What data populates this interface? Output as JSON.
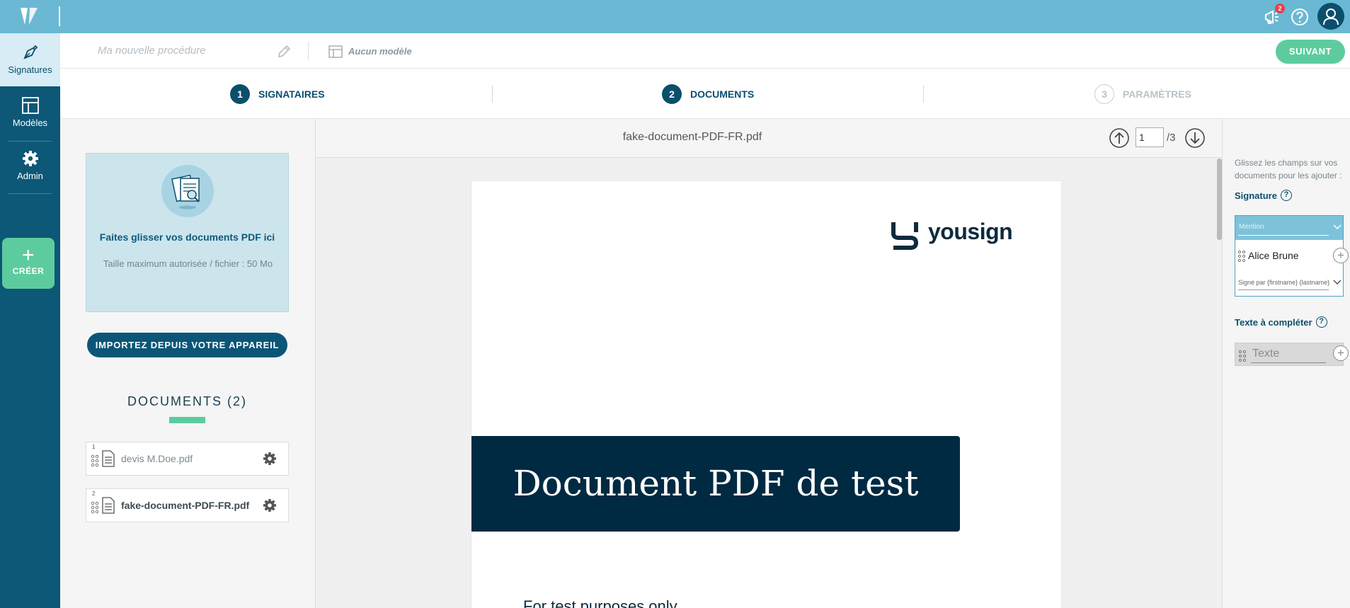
{
  "topbar": {
    "notification_count": "2"
  },
  "sidebar": {
    "items": [
      {
        "label": "Signatures",
        "icon": "pen-nib-icon",
        "active": true
      },
      {
        "label": "Modèles",
        "icon": "layout-icon",
        "active": false
      },
      {
        "label": "Admin",
        "icon": "gear-icon",
        "active": false
      }
    ],
    "create_label": "CRÉER",
    "create_symbol": "+"
  },
  "subheader": {
    "procedure_name": "Ma nouvelle procédure",
    "template_name": "Aucun modèle",
    "next_label": "SUIVANT"
  },
  "steps": [
    {
      "num": "1",
      "label": "SIGNATAIRES",
      "state": "done"
    },
    {
      "num": "2",
      "label": "DOCUMENTS",
      "state": "active"
    },
    {
      "num": "3",
      "label": "PARAMÈTRES",
      "state": "inactive"
    }
  ],
  "dropzone": {
    "title": "Faites glisser vos documents PDF ici",
    "subtitle": "Taille maximum autorisée / fichier : 50 Mo"
  },
  "import_label": "IMPORTEZ DEPUIS VOTRE APPAREIL",
  "documents": {
    "title": "DOCUMENTS (2)",
    "items": [
      {
        "index": "1",
        "name": "devis M.Doe.pdf",
        "selected": false
      },
      {
        "index": "2",
        "name": "fake-document-PDF-FR.pdf",
        "selected": true
      }
    ]
  },
  "viewer": {
    "file_title": "fake-document-PDF-FR.pdf",
    "page_current": "1",
    "page_total": "/3",
    "pdf": {
      "logo_text": "yousign",
      "banner_title": "Document PDF de test",
      "body_text": "For test purposes only"
    }
  },
  "right_panel": {
    "help_text": "Glissez les champs sur vos documents pour les ajouter :",
    "signature_label": "Signature",
    "signature_field": {
      "mention_placeholder": "Mention",
      "signer_name": "Alice Brune",
      "signed_by": "Signé par {firstname} {lastname}"
    },
    "text_label": "Texte à compléter",
    "text_field": {
      "placeholder": "Texte"
    },
    "help_symbol": "?",
    "add_symbol": "+"
  },
  "colors": {
    "topbar": "#6bb8d4",
    "sidebar": "#0d5777",
    "accent_green": "#5ccc9e",
    "primary_blue": "#0b4f6c",
    "pdf_banner": "#002a42"
  }
}
